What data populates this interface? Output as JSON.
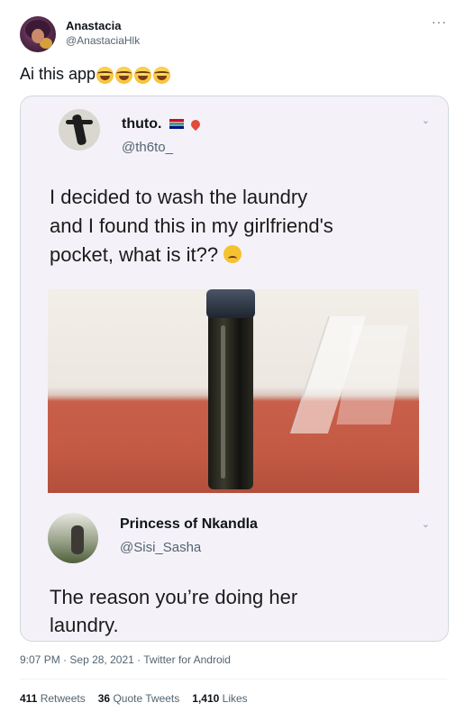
{
  "author": {
    "name": "Anastacia",
    "handle": "@AnastaciaHlk"
  },
  "tweet": {
    "text": "Ai this app",
    "emoji_count": 4
  },
  "embedded": {
    "post1": {
      "name": "thuto.",
      "handle": "@th6to_",
      "text_line1": "I decided to wash the laundry",
      "text_line2": "and I found this in my girlfriend's",
      "text_line3": "pocket, what is it??"
    },
    "post2": {
      "name": "Princess of Nkandla",
      "handle": "@Sisi_Sasha",
      "text_line1": "The reason you’re doing her",
      "text_line2": "laundry."
    }
  },
  "meta": {
    "time": "9:07 PM",
    "date": "Sep 28, 2021",
    "separator": "·",
    "source": "Twitter for Android"
  },
  "stats": {
    "retweets_count": "411",
    "retweets_label": "Retweets",
    "quotes_count": "36",
    "quotes_label": "Quote Tweets",
    "likes_count": "1,410",
    "likes_label": "Likes"
  },
  "icons": {
    "more": "more-dots-icon",
    "chevron": "chevron-down-icon"
  }
}
